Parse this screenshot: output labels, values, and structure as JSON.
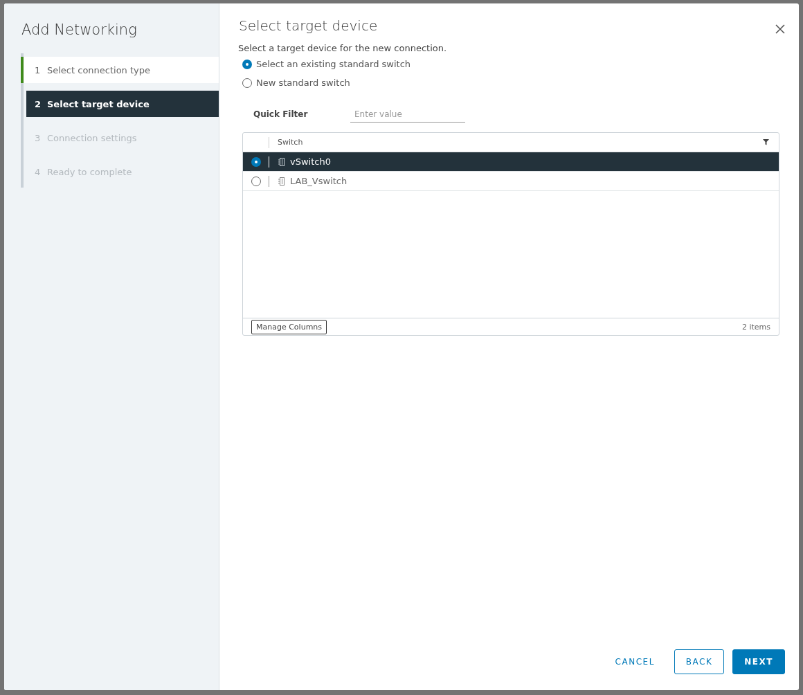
{
  "wizard": {
    "title": "Add Networking",
    "steps": [
      {
        "number": "1",
        "label": "Select connection type",
        "selected": false,
        "completed": true
      },
      {
        "number": "2",
        "label": "Select target device",
        "selected": true,
        "completed": false
      },
      {
        "number": "3",
        "label": "Connection settings",
        "selected": false,
        "completed": false
      },
      {
        "number": "4",
        "label": "Ready to complete",
        "selected": false,
        "completed": false
      }
    ]
  },
  "page": {
    "title": "Select target device",
    "description": "Select a target device for the new connection.",
    "options": [
      {
        "label": "Select an existing standard switch",
        "selected": true
      },
      {
        "label": "New standard switch",
        "selected": false
      }
    ],
    "quick_filter": {
      "label": "Quick Filter",
      "placeholder": "Enter value"
    },
    "table": {
      "columns": [
        "Switch"
      ],
      "rows": [
        {
          "name": "vSwitch0",
          "selected": true
        },
        {
          "name": "LAB_Vswitch",
          "selected": false
        }
      ],
      "footer_button": "Manage Columns",
      "count": "2 items"
    }
  },
  "buttons": [
    {
      "label": "CANCEL",
      "kind": "link"
    },
    {
      "label": "BACK",
      "kind": "outline"
    },
    {
      "label": "NEXT",
      "kind": "primary"
    }
  ]
}
